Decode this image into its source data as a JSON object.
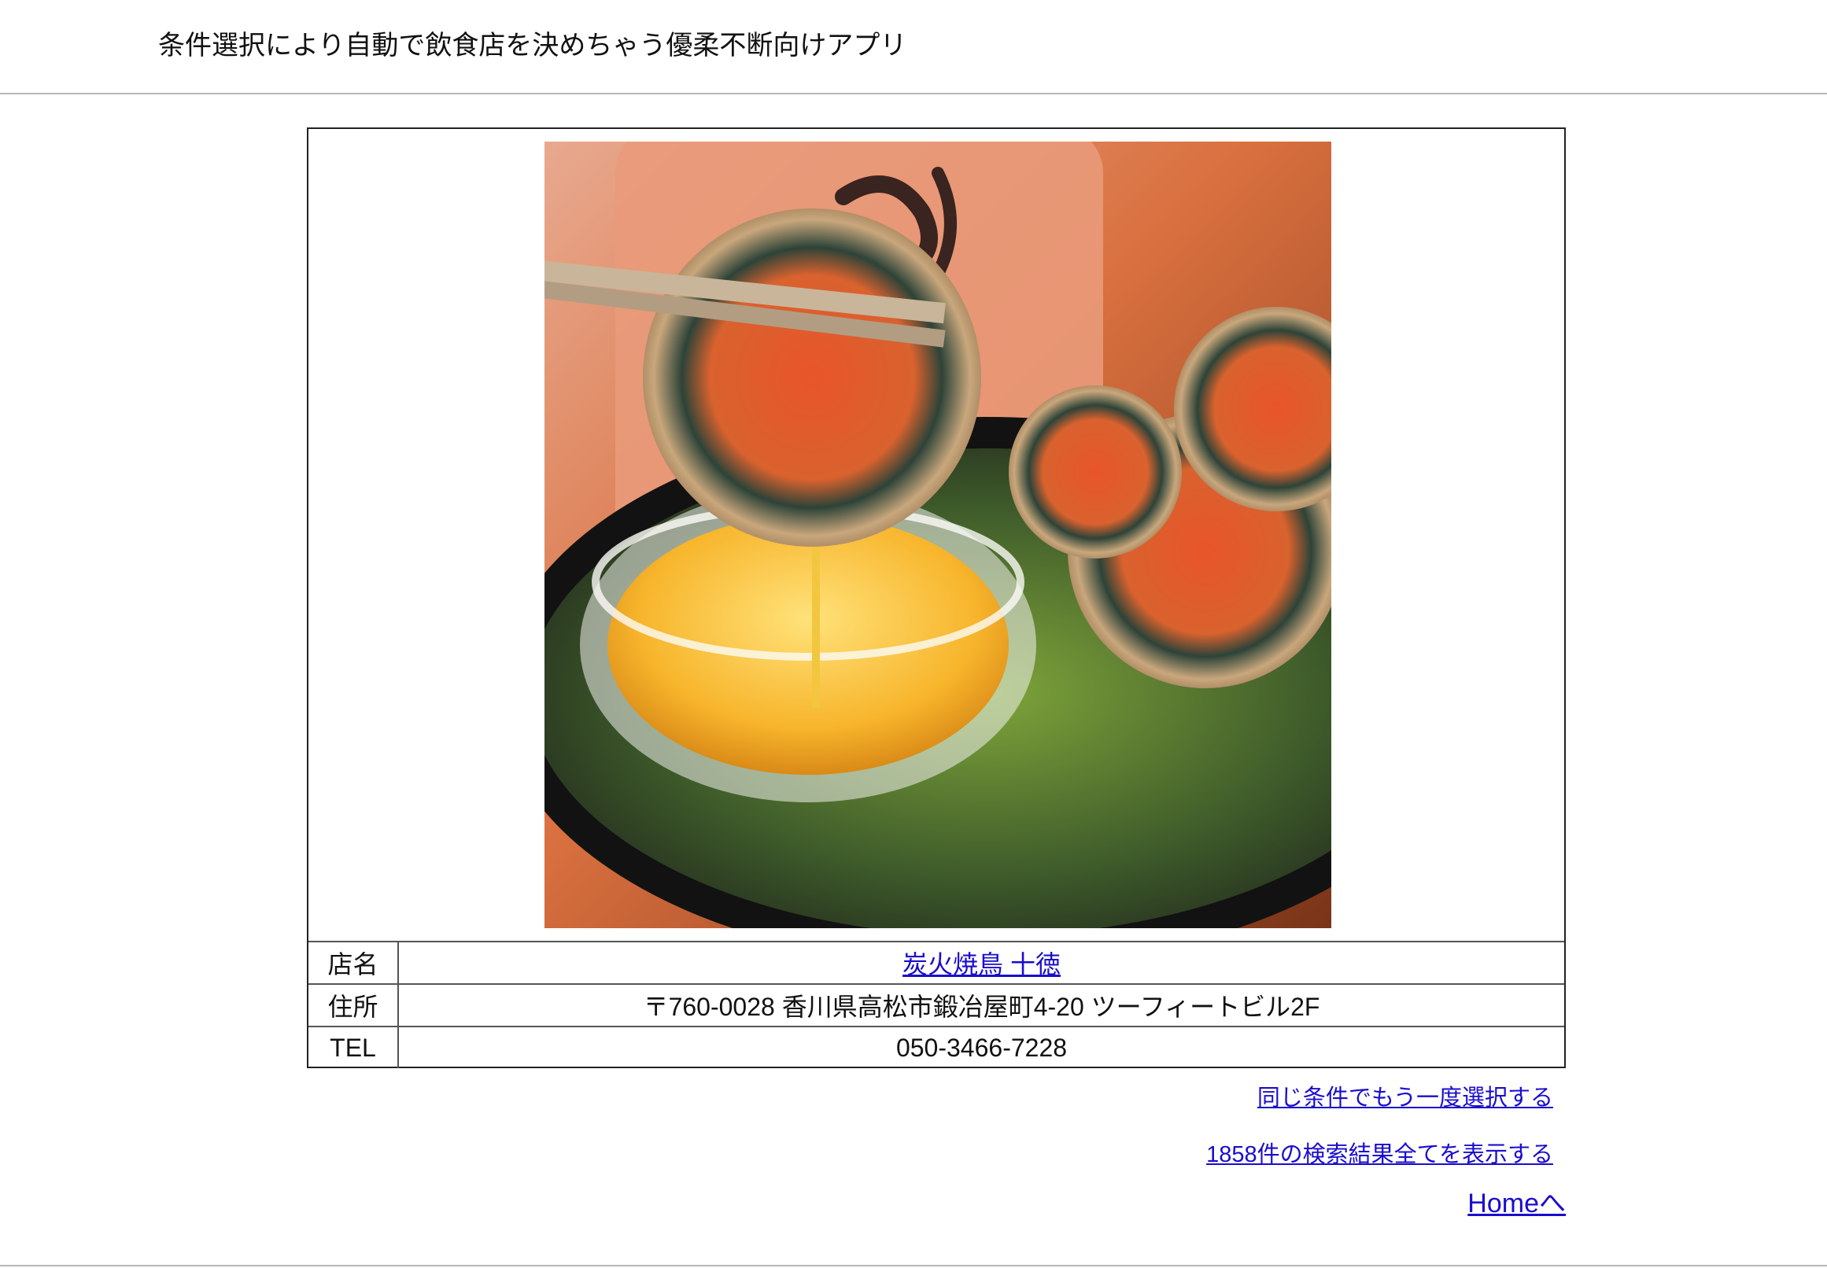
{
  "header": {
    "title": "条件選択により自動で飲食店を決めちゃう優柔不断向けアプリ"
  },
  "shop": {
    "photo_icon": "food-photo",
    "rows": [
      {
        "label": "店名",
        "value": "炭火焼鳥 十徳",
        "is_link": true
      },
      {
        "label": "住所",
        "value": "〒760-0028 香川県高松市鍛冶屋町4-20 ツーフィートビル2F",
        "is_link": false
      },
      {
        "label": "TEL",
        "value": "050-3466-7228",
        "is_link": false
      }
    ]
  },
  "links": {
    "again": "同じ条件でもう一度選択する",
    "all_results": "1858件の検索結果全てを表示する",
    "home": "Homeへ"
  },
  "colors": {
    "link": "#1a0dcc",
    "border": "#222222",
    "divider": "#b8b8b8"
  }
}
